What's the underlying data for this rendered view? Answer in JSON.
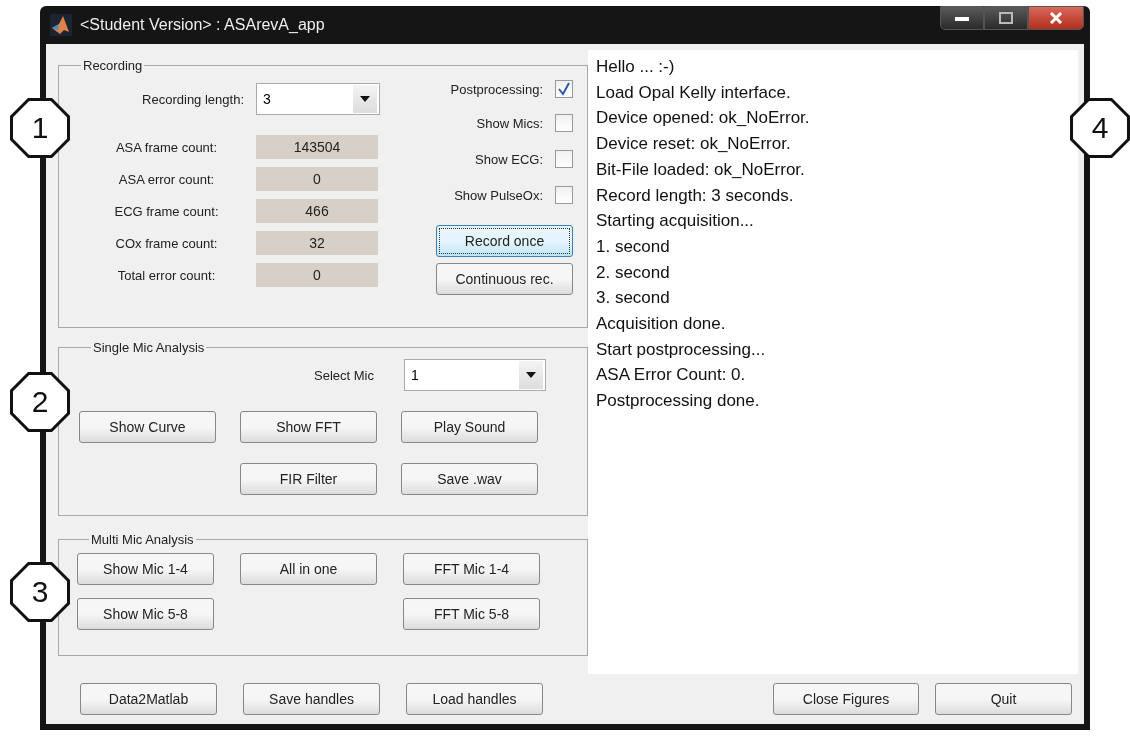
{
  "window": {
    "title": "<Student Version> : ASArevA_app"
  },
  "callouts": [
    "1",
    "2",
    "3",
    "4"
  ],
  "recording": {
    "title": "Recording",
    "length_label": "Recording length:",
    "length_value": "3",
    "counters": [
      {
        "label": "ASA frame count:",
        "value": "143504"
      },
      {
        "label": "ASA error count:",
        "value": "0"
      },
      {
        "label": "ECG frame count:",
        "value": "466"
      },
      {
        "label": "COx frame count:",
        "value": "32"
      },
      {
        "label": "Total error count:",
        "value": "0"
      }
    ],
    "options": [
      {
        "label": "Postprocessing:",
        "checked": true
      },
      {
        "label": "Show Mics:",
        "checked": false
      },
      {
        "label": "Show ECG:",
        "checked": false
      },
      {
        "label": "Show PulseOx:",
        "checked": false
      }
    ],
    "buttons": [
      {
        "label": "Record once",
        "focused": true
      },
      {
        "label": "Continuous rec.",
        "focused": false
      }
    ]
  },
  "single_mic": {
    "title": "Single Mic Analysis",
    "select_label": "Select Mic",
    "select_value": "1",
    "row_1": [
      "Show Curve",
      "Show FFT",
      "Play Sound"
    ],
    "row_2": [
      "FIR Filter",
      "Save .wav"
    ]
  },
  "multi_mic": {
    "title": "Multi Mic Analysis",
    "row_1": [
      "Show Mic 1-4",
      "All in one",
      "FFT Mic 1-4"
    ],
    "row_2": [
      "Show Mic 5-8",
      "FFT Mic 5-8"
    ]
  },
  "bottom_left": [
    "Data2Matlab",
    "Save handles",
    "Load handles"
  ],
  "log": [
    "Hello ... :-)",
    "Load Opal Kelly interface.",
    "Device opened: ok_NoError.",
    "Device reset: ok_NoError.",
    "Bit-File loaded: ok_NoError.",
    "Record length: 3 seconds.",
    "Starting acquisition...",
    "1. second",
    "2. second",
    "3. second",
    "Acquisition done.",
    "Start postprocessing...",
    "ASA Error Count: 0.",
    "Postprocessing done."
  ],
  "bottom_right": [
    "Close Figures",
    "Quit"
  ]
}
